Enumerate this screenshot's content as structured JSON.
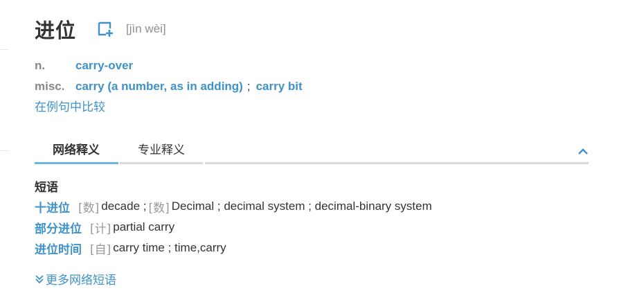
{
  "entry": {
    "word": "进位",
    "pinyin": "[jìn wèi]"
  },
  "definitions": [
    {
      "pos": "n.",
      "items": [
        "carry-over"
      ]
    },
    {
      "pos": "misc.",
      "items": [
        "carry (a number, as in adding)",
        "carry bit"
      ],
      "separator": ";"
    }
  ],
  "compare_link": "在例句中比较",
  "tabs": [
    {
      "label": "网络释义",
      "active": true
    },
    {
      "label": "专业释义",
      "active": false
    }
  ],
  "phrases": {
    "title": "短语",
    "rows": [
      {
        "word": "十进位",
        "tag1": "[数]",
        "text1": "decade ;",
        "tag2": "[数]",
        "text2": "Decimal ; decimal system ; decimal-binary system"
      },
      {
        "word": "部分进位",
        "tag1": "[计]",
        "text1": "partial carry"
      },
      {
        "word": "进位时间",
        "tag1": "[自]",
        "text1": "carry time ; time,carry"
      }
    ]
  },
  "more_link": "更多网络短语",
  "colors": {
    "accent": "#3e92c8",
    "active_tab_line": "#6cb5e0",
    "muted": "#999999"
  },
  "icons": {
    "favorite": "add-to-wordbook-icon",
    "collapse": "chevron-up-icon",
    "more": "double-chevron-down-icon"
  }
}
